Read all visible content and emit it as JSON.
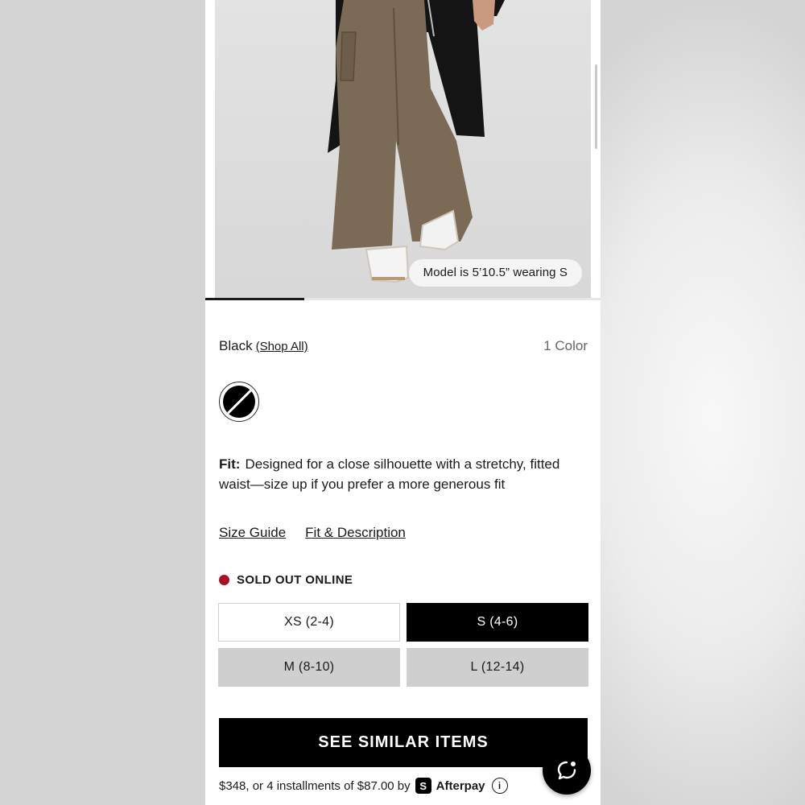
{
  "product_image": {
    "model_badge": "Model is 5’10.5” wearing S",
    "progress": 0.25
  },
  "color": {
    "selected_name": "Black",
    "shop_all_label": "(Shop All)",
    "count_label": "1 Color",
    "swatch_color": "#000000"
  },
  "fit": {
    "label": "Fit:",
    "text": "Designed for a close silhouette with a stretchy, fitted waist—size up if you prefer a more generous fit"
  },
  "links": {
    "size_guide": "Size Guide",
    "fit_description": "Fit & Description"
  },
  "stock": {
    "status": "SOLD OUT ONLINE",
    "status_color": "#a8102a"
  },
  "sizes": [
    {
      "label": "XS (2-4)",
      "state": "outline"
    },
    {
      "label": "S (4-6)",
      "state": "selected"
    },
    {
      "label": "M (8-10)",
      "state": "soldout"
    },
    {
      "label": "L (12-14)",
      "state": "soldout"
    }
  ],
  "cta": {
    "label": "SEE SIMILAR ITEMS"
  },
  "afterpay": {
    "text": "$348, or 4 installments of $87.00 by",
    "logo_glyph": "S",
    "brand": "Afterpay",
    "info_glyph": "i"
  },
  "icons": {
    "chat": "chat-bubble-icon"
  }
}
